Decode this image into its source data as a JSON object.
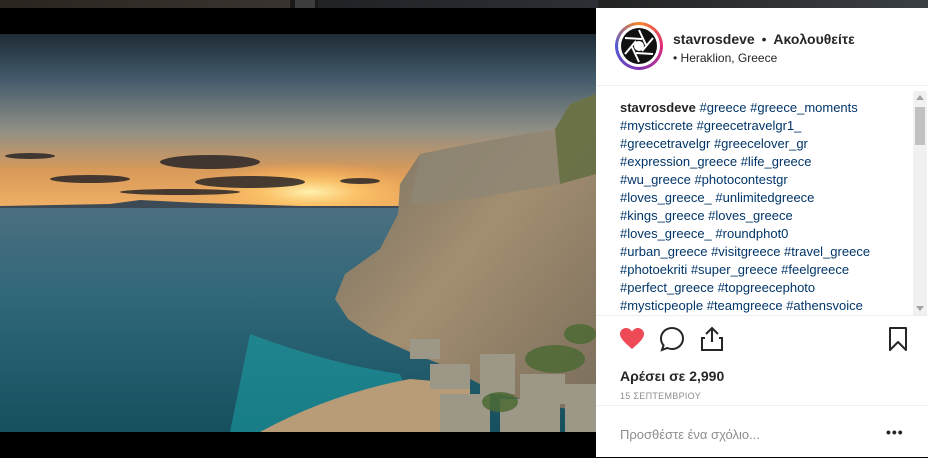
{
  "post": {
    "username": "stavrosdeve",
    "separator": "•",
    "follow_label": "Ακολουθείτε",
    "location_prefix": "•",
    "location": "Heraklion, Greece"
  },
  "caption": {
    "username": "stavrosdeve",
    "lines": [
      "#greece #greece_moments",
      "#mysticcrete #greecetravelgr1_",
      "#greecetravelgr #greecelover_gr",
      "#expression_greece #life_greece",
      "#wu_greece #photocontestgr",
      "#loves_greece_ #unlimitedgreece",
      "#kings_greece #loves_greece",
      "#loves_greece_ #roundphot0",
      "#urban_greece #visitgreece #travel_greece",
      "#photoekriti #super_greece #feelgreece",
      "#perfect_greece #topgreecephoto",
      "#mysticpeople #teamgreece #athensvoice"
    ]
  },
  "actions": {
    "like_icon": "heart-filled-icon",
    "comment_icon": "comment-icon",
    "share_icon": "share-icon",
    "save_icon": "bookmark-icon",
    "likes_text": "Αρέσει σε 2,990",
    "date_text": "15 ΣΕΠΤΕΜΒΡΙΟΥ"
  },
  "comment": {
    "placeholder": "Προσθέστε ένα σχόλιο...",
    "more_label": "•••"
  },
  "colors": {
    "like": "#ed4956",
    "hashtag": "#003569",
    "text": "#262626",
    "muted": "#8e8e8e"
  }
}
